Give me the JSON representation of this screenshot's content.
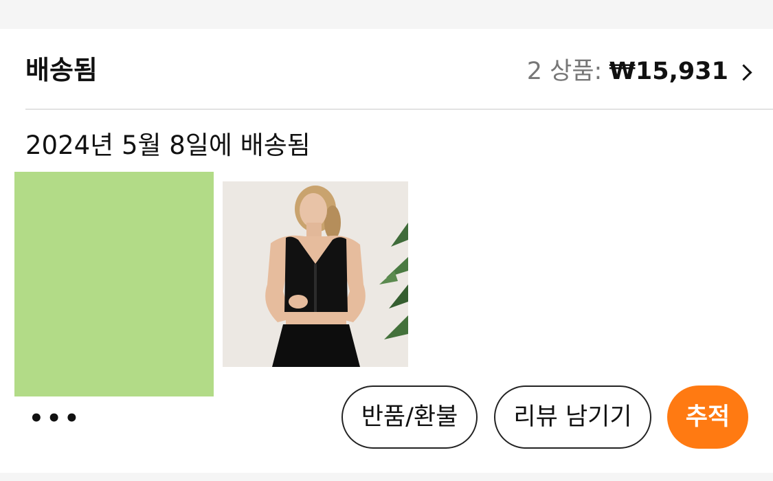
{
  "order": {
    "status_title": "배송됨",
    "item_count": "2 상품",
    "total_colon": ":",
    "total_amount": "₩15,931",
    "delivered_text": "2024년 5월 8일에 배송됨"
  },
  "thumbnails": [
    {
      "kind": "placeholder",
      "color": "#b2db87"
    },
    {
      "kind": "photo",
      "depicts": "woman in black sports bra"
    }
  ],
  "actions": {
    "more": "•••",
    "return_refund": "반품/환불",
    "leave_review": "리뷰 남기기",
    "track": "추적"
  },
  "colors": {
    "accent": "#ff7a12",
    "muted_text": "#777777",
    "thumbnail_green": "#b2db87"
  }
}
